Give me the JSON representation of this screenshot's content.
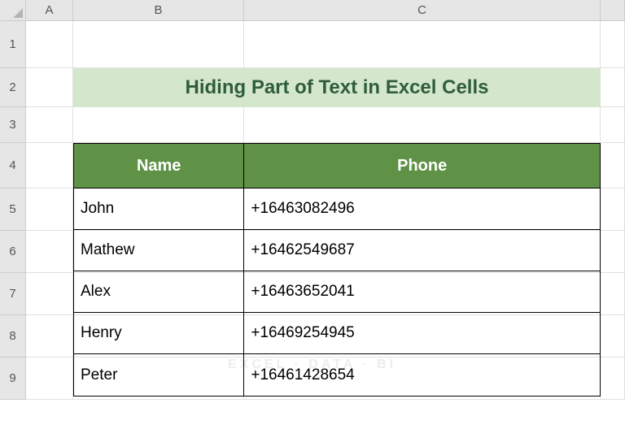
{
  "columns": [
    "A",
    "B",
    "C"
  ],
  "rows": [
    "1",
    "2",
    "3",
    "4",
    "5",
    "6",
    "7",
    "8",
    "9"
  ],
  "title": "Hiding Part of Text in Excel Cells",
  "watermark": "EXCEL · DATA · BI",
  "table": {
    "headers": {
      "name": "Name",
      "phone": "Phone"
    },
    "data": [
      {
        "name": "John",
        "phone": "+16463082496"
      },
      {
        "name": "Mathew",
        "phone": "+16462549687"
      },
      {
        "name": "Alex",
        "phone": "+16463652041"
      },
      {
        "name": "Henry",
        "phone": "+16469254945"
      },
      {
        "name": "Peter",
        "phone": "+16461428654"
      }
    ]
  }
}
